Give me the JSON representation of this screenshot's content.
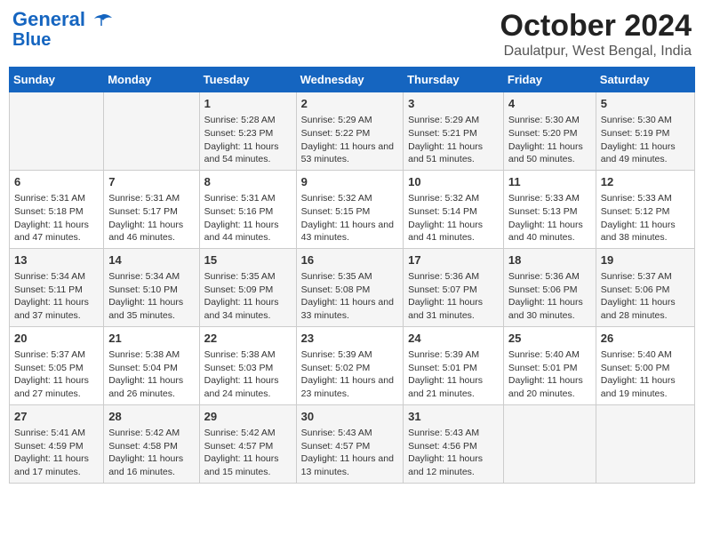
{
  "header": {
    "logo_line1": "General",
    "logo_line2": "Blue",
    "title": "October 2024",
    "subtitle": "Daulatpur, West Bengal, India"
  },
  "days_of_week": [
    "Sunday",
    "Monday",
    "Tuesday",
    "Wednesday",
    "Thursday",
    "Friday",
    "Saturday"
  ],
  "weeks": [
    [
      {
        "day": "",
        "content": ""
      },
      {
        "day": "",
        "content": ""
      },
      {
        "day": "1",
        "content": "Sunrise: 5:28 AM\nSunset: 5:23 PM\nDaylight: 11 hours and 54 minutes."
      },
      {
        "day": "2",
        "content": "Sunrise: 5:29 AM\nSunset: 5:22 PM\nDaylight: 11 hours and 53 minutes."
      },
      {
        "day": "3",
        "content": "Sunrise: 5:29 AM\nSunset: 5:21 PM\nDaylight: 11 hours and 51 minutes."
      },
      {
        "day": "4",
        "content": "Sunrise: 5:30 AM\nSunset: 5:20 PM\nDaylight: 11 hours and 50 minutes."
      },
      {
        "day": "5",
        "content": "Sunrise: 5:30 AM\nSunset: 5:19 PM\nDaylight: 11 hours and 49 minutes."
      }
    ],
    [
      {
        "day": "6",
        "content": "Sunrise: 5:31 AM\nSunset: 5:18 PM\nDaylight: 11 hours and 47 minutes."
      },
      {
        "day": "7",
        "content": "Sunrise: 5:31 AM\nSunset: 5:17 PM\nDaylight: 11 hours and 46 minutes."
      },
      {
        "day": "8",
        "content": "Sunrise: 5:31 AM\nSunset: 5:16 PM\nDaylight: 11 hours and 44 minutes."
      },
      {
        "day": "9",
        "content": "Sunrise: 5:32 AM\nSunset: 5:15 PM\nDaylight: 11 hours and 43 minutes."
      },
      {
        "day": "10",
        "content": "Sunrise: 5:32 AM\nSunset: 5:14 PM\nDaylight: 11 hours and 41 minutes."
      },
      {
        "day": "11",
        "content": "Sunrise: 5:33 AM\nSunset: 5:13 PM\nDaylight: 11 hours and 40 minutes."
      },
      {
        "day": "12",
        "content": "Sunrise: 5:33 AM\nSunset: 5:12 PM\nDaylight: 11 hours and 38 minutes."
      }
    ],
    [
      {
        "day": "13",
        "content": "Sunrise: 5:34 AM\nSunset: 5:11 PM\nDaylight: 11 hours and 37 minutes."
      },
      {
        "day": "14",
        "content": "Sunrise: 5:34 AM\nSunset: 5:10 PM\nDaylight: 11 hours and 35 minutes."
      },
      {
        "day": "15",
        "content": "Sunrise: 5:35 AM\nSunset: 5:09 PM\nDaylight: 11 hours and 34 minutes."
      },
      {
        "day": "16",
        "content": "Sunrise: 5:35 AM\nSunset: 5:08 PM\nDaylight: 11 hours and 33 minutes."
      },
      {
        "day": "17",
        "content": "Sunrise: 5:36 AM\nSunset: 5:07 PM\nDaylight: 11 hours and 31 minutes."
      },
      {
        "day": "18",
        "content": "Sunrise: 5:36 AM\nSunset: 5:06 PM\nDaylight: 11 hours and 30 minutes."
      },
      {
        "day": "19",
        "content": "Sunrise: 5:37 AM\nSunset: 5:06 PM\nDaylight: 11 hours and 28 minutes."
      }
    ],
    [
      {
        "day": "20",
        "content": "Sunrise: 5:37 AM\nSunset: 5:05 PM\nDaylight: 11 hours and 27 minutes."
      },
      {
        "day": "21",
        "content": "Sunrise: 5:38 AM\nSunset: 5:04 PM\nDaylight: 11 hours and 26 minutes."
      },
      {
        "day": "22",
        "content": "Sunrise: 5:38 AM\nSunset: 5:03 PM\nDaylight: 11 hours and 24 minutes."
      },
      {
        "day": "23",
        "content": "Sunrise: 5:39 AM\nSunset: 5:02 PM\nDaylight: 11 hours and 23 minutes."
      },
      {
        "day": "24",
        "content": "Sunrise: 5:39 AM\nSunset: 5:01 PM\nDaylight: 11 hours and 21 minutes."
      },
      {
        "day": "25",
        "content": "Sunrise: 5:40 AM\nSunset: 5:01 PM\nDaylight: 11 hours and 20 minutes."
      },
      {
        "day": "26",
        "content": "Sunrise: 5:40 AM\nSunset: 5:00 PM\nDaylight: 11 hours and 19 minutes."
      }
    ],
    [
      {
        "day": "27",
        "content": "Sunrise: 5:41 AM\nSunset: 4:59 PM\nDaylight: 11 hours and 17 minutes."
      },
      {
        "day": "28",
        "content": "Sunrise: 5:42 AM\nSunset: 4:58 PM\nDaylight: 11 hours and 16 minutes."
      },
      {
        "day": "29",
        "content": "Sunrise: 5:42 AM\nSunset: 4:57 PM\nDaylight: 11 hours and 15 minutes."
      },
      {
        "day": "30",
        "content": "Sunrise: 5:43 AM\nSunset: 4:57 PM\nDaylight: 11 hours and 13 minutes."
      },
      {
        "day": "31",
        "content": "Sunrise: 5:43 AM\nSunset: 4:56 PM\nDaylight: 11 hours and 12 minutes."
      },
      {
        "day": "",
        "content": ""
      },
      {
        "day": "",
        "content": ""
      }
    ]
  ]
}
